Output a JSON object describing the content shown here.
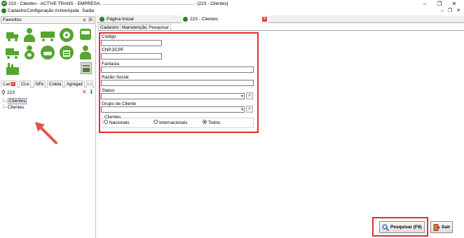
{
  "window": {
    "title": "223 - Clientes - ACTIVE TRANS - EMPRESA: ........................................................................ - [223 - Clientes]",
    "app_icon_text": "AT",
    "controls": {
      "minimize": "–",
      "restore": "❐",
      "close": "✕"
    }
  },
  "menubar": {
    "items": [
      "Cadastro",
      "Configuração Active",
      "Ajuda",
      "Saída"
    ],
    "mdi_controls": {
      "minimize": "–",
      "restore": "❐",
      "close": "✕"
    }
  },
  "favorites": {
    "label": "Favoritos",
    "icons": [
      "truck-plus-icon",
      "person-icon",
      "truck-convoy-icon",
      "steering-wheel-icon",
      "bus-icon",
      "delivery-truck-icon",
      "driver-icon",
      "road-car-icon",
      "garage-icon",
      "worker-icon",
      "factory-icon",
      "document-box-icon"
    ]
  },
  "left_tabs": [
    "Cad",
    "Ct-e",
    "NFe",
    "Coleta",
    "Agregad"
  ],
  "left_tab_arrow": "‹ ›",
  "search": {
    "value": "223"
  },
  "tree": {
    "items": [
      "Clientes",
      "Clientes"
    ]
  },
  "doc_tabs": [
    {
      "label": "Página Inicial"
    },
    {
      "label": "223 - Clientes"
    }
  ],
  "doc_tab_close": "✕",
  "sub_tabs": [
    "Cadastro",
    "Manutenção",
    "Pesquisar"
  ],
  "form": {
    "codigo_label": "Código",
    "cnpj_label": "CNPJ/CPF",
    "fantasia_label": "Fantasia",
    "razao_label": "Razão Social",
    "status_label": "Status",
    "grupo_label": "Grupo de Cliente",
    "clientes_group_label": "Clientes",
    "radios": [
      {
        "label": "Nacionais",
        "checked": false
      },
      {
        "label": "Internacionais",
        "checked": false
      },
      {
        "label": "Todos",
        "checked": true
      }
    ],
    "dropdown_arrow": "▾",
    "add_icon_text": "+"
  },
  "buttons": {
    "search_label": "Pesquisar (F8)",
    "exit_label": "Sair"
  },
  "colors": {
    "highlight": "#e03030",
    "arrow": "#e0554a",
    "icon_green": "#55a630"
  }
}
